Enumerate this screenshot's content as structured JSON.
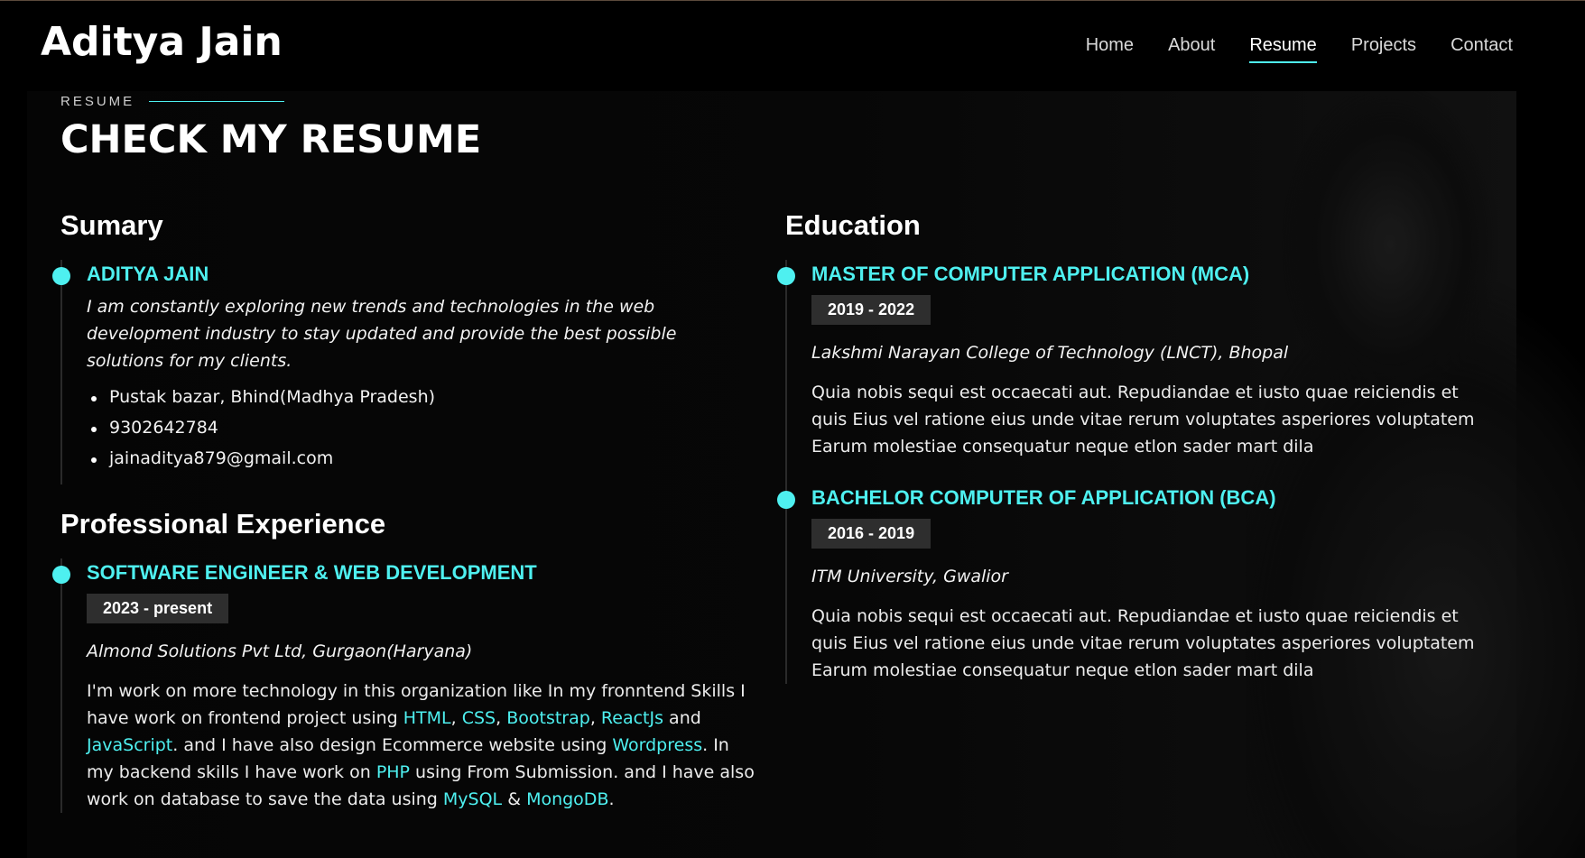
{
  "header": {
    "logo": "Aditya Jain",
    "nav": [
      {
        "label": "Home"
      },
      {
        "label": "About"
      },
      {
        "label": "Resume",
        "active": true
      },
      {
        "label": "Projects"
      },
      {
        "label": "Contact"
      }
    ]
  },
  "section": {
    "label": "RESUME",
    "title": "CHECK MY RESUME"
  },
  "summary": {
    "heading": "Sumary",
    "name": "ADITYA JAIN",
    "bio": "I am constantly exploring new trends and technologies in the web development industry to stay updated and provide the best possible solutions for my clients.",
    "contacts": [
      "Pustak bazar, Bhind(Madhya Pradesh)",
      "9302642784",
      "jainaditya879@gmail.com"
    ]
  },
  "experience": {
    "heading": "Professional Experience",
    "title": "SOFTWARE ENGINEER & WEB DEVELOPMENT",
    "dates": "2023 - present",
    "company": "Almond Solutions Pvt Ltd, Gurgaon(Haryana)",
    "desc": {
      "p1": "I'm work on more technology in this organization like In my fronntend Skills I have work on frontend project using ",
      "html": "HTML",
      "comma1": ", ",
      "css": "CSS",
      "comma2": ", ",
      "bootstrap": "Bootstrap",
      "comma3": ", ",
      "reactjs": "ReactJs",
      "and1": " and ",
      "javascript": "JavaScript",
      "p2": ". and I have also design Ecommerce website using ",
      "wordpress": "Wordpress",
      "p3": ". In my backend skills I have work on ",
      "php": "PHP",
      "p4": " using From Submission. and I have also work on database to save the data using ",
      "mysql": "MySQL",
      "amp": " & ",
      "mongodb": "MongoDB",
      "end": "."
    }
  },
  "education": {
    "heading": "Education",
    "items": [
      {
        "title": "MASTER OF COMPUTER APPLICATION (MCA)",
        "dates": "2019 - 2022",
        "school": "Lakshmi Narayan College of Technology (LNCT), Bhopal",
        "desc": "Quia nobis sequi est occaecati aut. Repudiandae et iusto quae reiciendis et quis Eius vel ratione eius unde vitae rerum voluptates asperiores voluptatem Earum molestiae consequatur neque etlon sader mart dila"
      },
      {
        "title": "BACHELOR COMPUTER OF APPLICATION (BCA)",
        "dates": "2016 - 2019",
        "school": "ITM University, Gwalior",
        "desc": "Quia nobis sequi est occaecati aut. Repudiandae et iusto quae reiciendis et quis Eius vel ratione eius unde vitae rerum voluptates asperiores voluptatem Earum molestiae consequatur neque etlon sader mart dila"
      }
    ]
  },
  "colors": {
    "accent": "#4ef0f0",
    "background": "#000000",
    "badge": "#2e2e2e"
  }
}
